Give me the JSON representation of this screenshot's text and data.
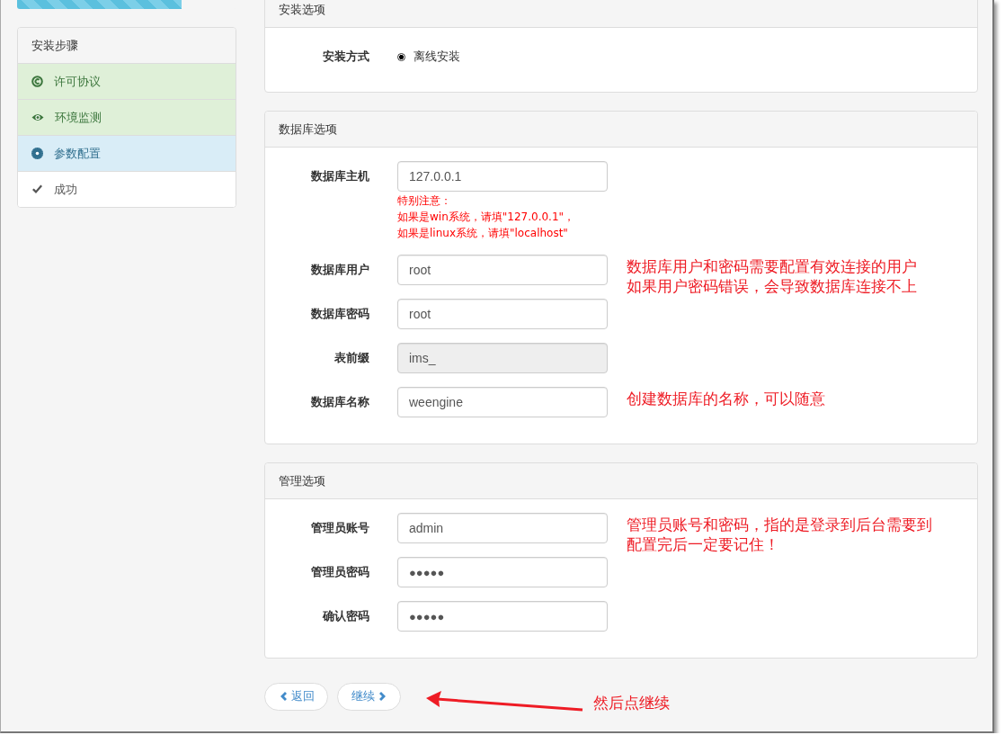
{
  "progress": {
    "level": 0.75
  },
  "steps": {
    "title": "安装步骤",
    "items": [
      {
        "label": "许可协议",
        "done": true,
        "selected": false
      },
      {
        "label": "环境监测",
        "done": true,
        "selected": false
      },
      {
        "label": "参数配置",
        "selected": true
      },
      {
        "label": "成功",
        "done": false,
        "selected": false
      }
    ]
  },
  "sections": [
    {
      "title": "安装选项",
      "fields": [
        {
          "kind": "radio",
          "label": "安装方式",
          "options": [
            {
              "label": "离线安装",
              "selected": true
            }
          ]
        }
      ]
    },
    {
      "title": "数据库选项",
      "fields": [
        {
          "kind": "text",
          "label": "数据库主机",
          "value": "127.0.0.1",
          "note": [
            "特别注意：",
            "如果是win系统，请填\"127.0.0.1\"，",
            "如果是linux系统，请填\"localhost\""
          ]
        },
        {
          "kind": "text",
          "label": "数据库用户",
          "value": "root",
          "annotation": [
            "数据库用户和密码需要配置有效连接的用户",
            "如果用户密码错误，会导致数据库连接不上"
          ]
        },
        {
          "kind": "text",
          "label": "数据库密码",
          "value": "root"
        },
        {
          "kind": "readonly",
          "label": "表前缀",
          "value": "ims_"
        },
        {
          "kind": "text",
          "label": "数据库名称",
          "value": "weengine",
          "annotation": [
            "创建数据库的名称，可以随意"
          ]
        }
      ]
    },
    {
      "title": "管理选项",
      "fields": [
        {
          "kind": "text",
          "label": "管理员账号",
          "value": "admin",
          "annotation": [
            "管理员账号和密码，指的是登录到后台需要到",
            "配置完后一定要记住！"
          ]
        },
        {
          "kind": "password",
          "label": "管理员密码",
          "value": "●●●●●"
        },
        {
          "kind": "password",
          "label": "确认密码",
          "value": "●●●●●"
        }
      ]
    }
  ],
  "buttons": [
    {
      "label": "返回",
      "kind": "back"
    },
    {
      "label": "继续",
      "kind": "next"
    }
  ],
  "footer_annotation": "然后点继续"
}
